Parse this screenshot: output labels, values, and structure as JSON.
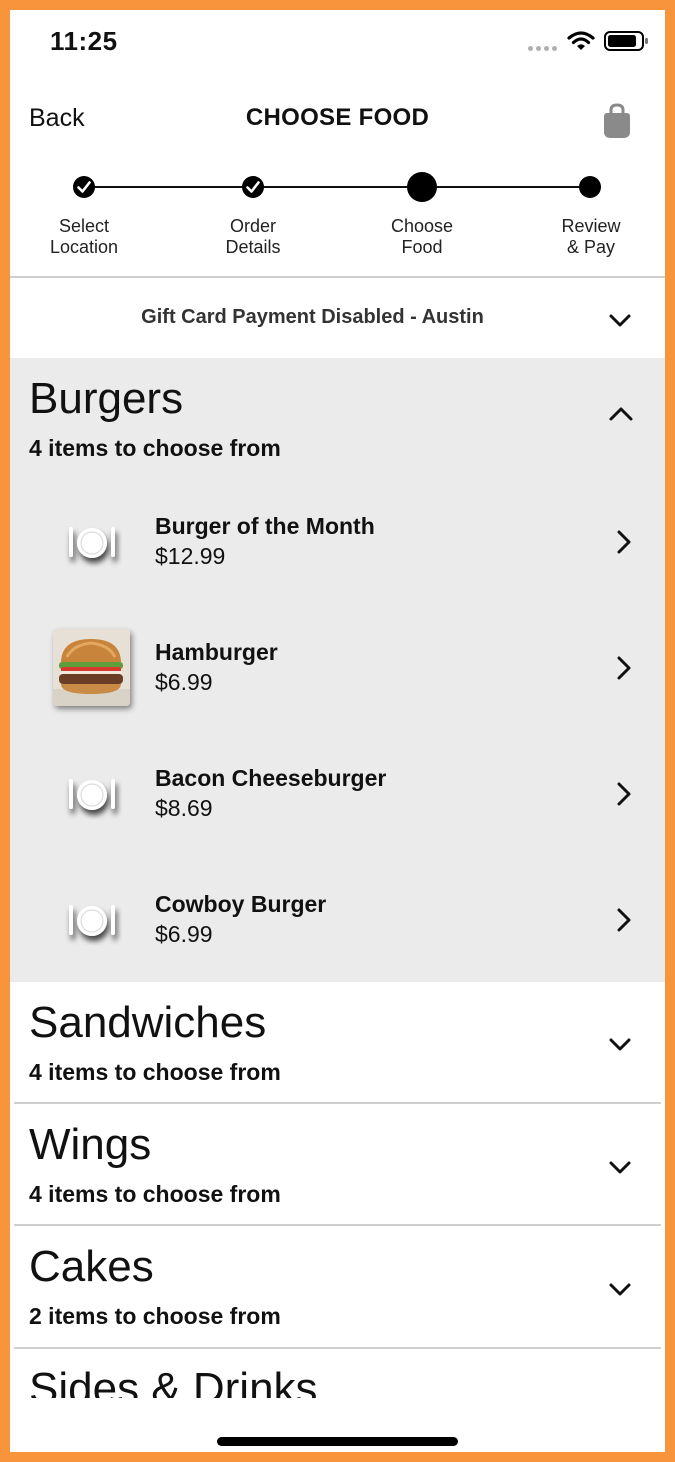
{
  "status_bar": {
    "time": "11:25"
  },
  "header": {
    "back_label": "Back",
    "title": "CHOOSE FOOD"
  },
  "stepper": {
    "steps": [
      {
        "line1": "Select",
        "line2": "Location",
        "state": "done"
      },
      {
        "line1": "Order",
        "line2": "Details",
        "state": "done"
      },
      {
        "line1": "Choose",
        "line2": "Food",
        "state": "current"
      },
      {
        "line1": "Review",
        "line2": "& Pay",
        "state": "pending"
      }
    ]
  },
  "location": {
    "text": "Gift Card Payment Disabled - Austin"
  },
  "categories": [
    {
      "name": "Burgers",
      "subtitle": "4 items to choose from",
      "expanded": true,
      "items": [
        {
          "name": "Burger of the Month",
          "price": "$12.99",
          "image": "plate-icon"
        },
        {
          "name": "Hamburger",
          "price": "$6.99",
          "image": "burger-photo"
        },
        {
          "name": "Bacon Cheeseburger",
          "price": "$8.69",
          "image": "plate-icon"
        },
        {
          "name": "Cowboy Burger",
          "price": "$6.99",
          "image": "plate-icon"
        }
      ]
    },
    {
      "name": "Sandwiches",
      "subtitle": "4 items to choose from",
      "expanded": false
    },
    {
      "name": "Wings",
      "subtitle": "4 items to choose from",
      "expanded": false
    },
    {
      "name": "Cakes",
      "subtitle": "2 items to choose from",
      "expanded": false
    },
    {
      "name": "Sides & Drinks",
      "expanded": false
    }
  ],
  "colors": {
    "frame": "#f8943c",
    "expanded_bg": "#ebebeb",
    "divider": "#cfcfcf"
  }
}
